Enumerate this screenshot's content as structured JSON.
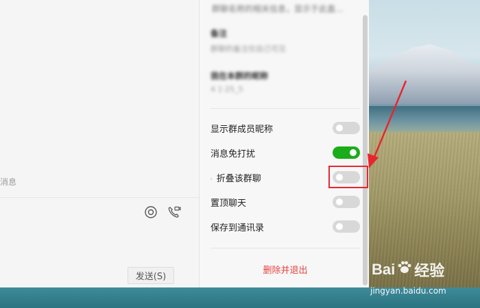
{
  "chat": {
    "history_hint": "消息",
    "send_button": "发送(S)",
    "tools": [
      {
        "icon": "emoji-icon"
      },
      {
        "icon": "video-call-icon"
      }
    ]
  },
  "panel": {
    "blurred_top_text": "群聊名称的相关信息，显示于此直...",
    "notes_title": "备注",
    "notes_value": "群聊的备注仅自己可见",
    "my_nickname_title": "我在本群的昵称",
    "my_nickname_value": "4 1·25_5",
    "settings": [
      {
        "label": "显示群成员昵称",
        "on": false,
        "sub": false
      },
      {
        "label": "消息免打扰",
        "on": true,
        "sub": false
      },
      {
        "label": "折叠该群聊",
        "on": false,
        "sub": true,
        "sub_mark": "˒"
      },
      {
        "label": "置顶聊天",
        "on": false,
        "sub": false
      },
      {
        "label": "保存到通讯录",
        "on": false,
        "sub": false
      }
    ],
    "delete_button": "删除并退出"
  },
  "colors": {
    "toggle_on": "#1aad19",
    "toggle_off": "#d8d8d8",
    "danger": "#e64340",
    "annotation": "#e6262e"
  },
  "watermark": {
    "brand": "Bai",
    "brand_suffix": "经验",
    "url": "jingyan.baidu.com"
  }
}
